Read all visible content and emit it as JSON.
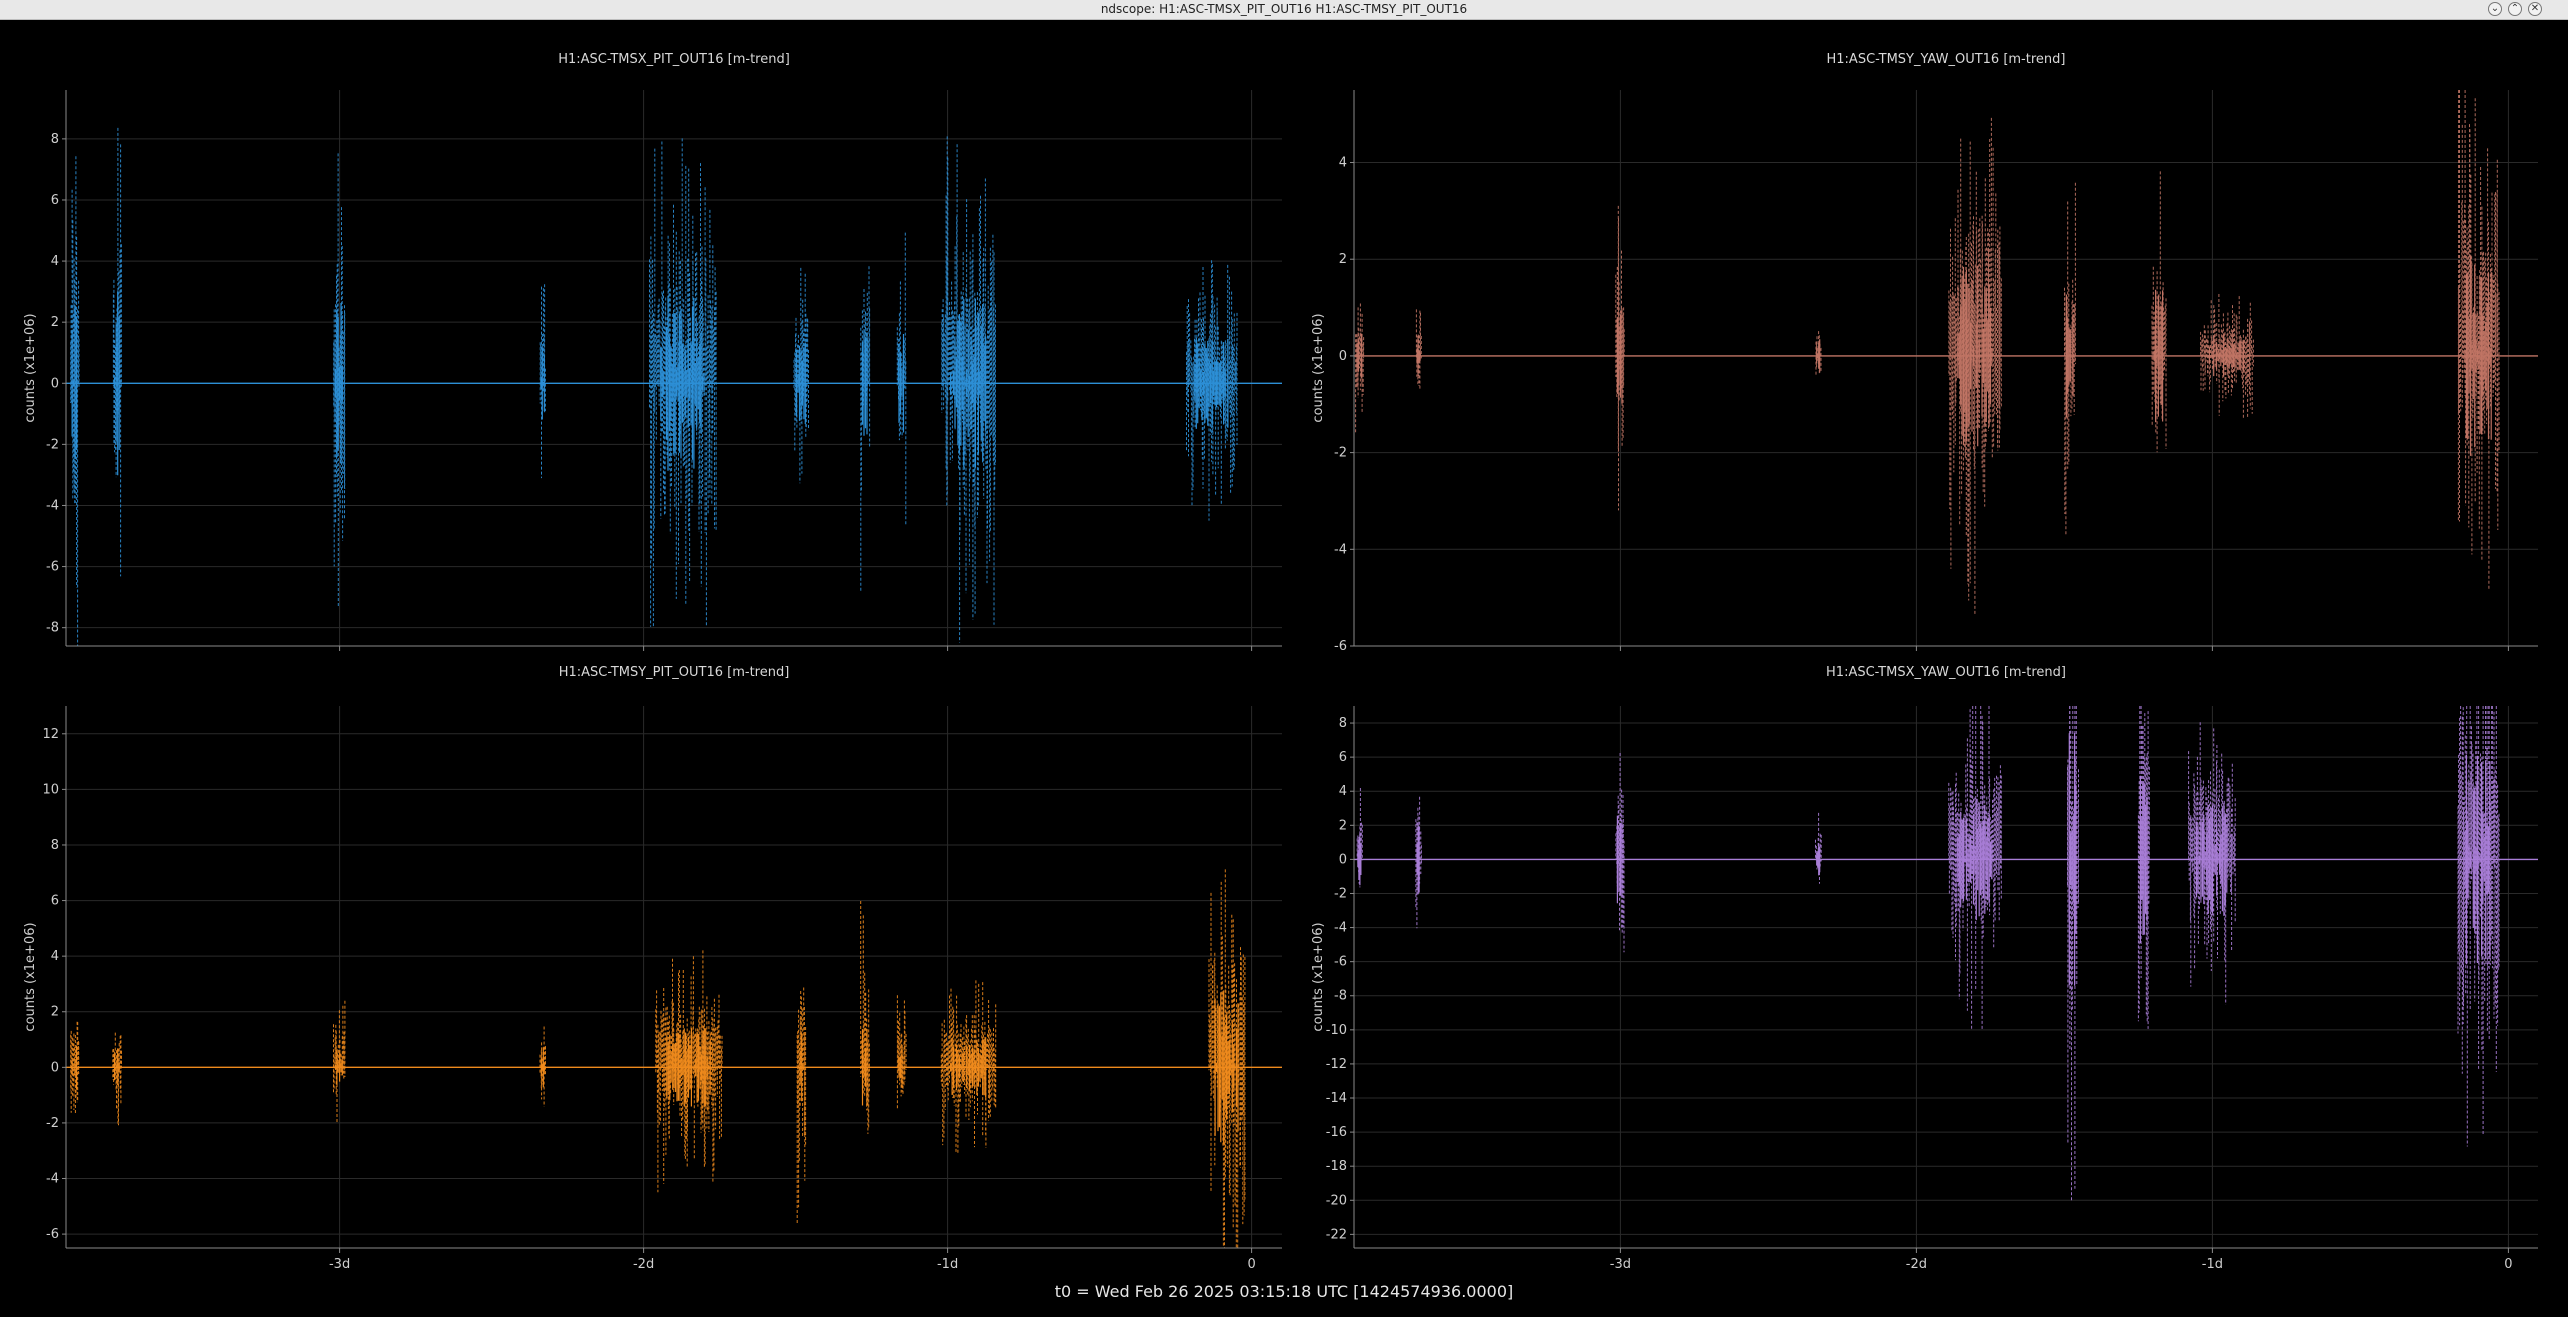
{
  "window": {
    "title": "ndscope: H1:ASC-TMSX_PIT_OUT16 H1:ASC-TMSY_PIT_OUT16"
  },
  "footer": {
    "t0": "t0 = Wed Feb 26 2025 03:15:18 UTC [1424574936.0000]"
  },
  "chart_data": [
    {
      "type": "line",
      "title": "H1:ASC-TMSX_PIT_OUT16 [m-trend]",
      "ylabel": "counts (x1e+06)",
      "color": "#2c8fd6",
      "xlim": [
        -3.9,
        0.1
      ],
      "ylim": [
        -8.6,
        9.6
      ],
      "x_ticks": [
        -3,
        -2,
        -1,
        0
      ],
      "x_tick_labels": [
        "-3d",
        "-2d",
        "-1d",
        "0"
      ],
      "y_ticks": [
        -8,
        -6,
        -4,
        -2,
        0,
        2,
        4,
        6,
        8
      ],
      "y_tick_labels": [
        "-8",
        "-6",
        "-4",
        "-2",
        "0",
        "2",
        "4",
        "6",
        "8"
      ],
      "bursts": [
        {
          "x": -3.87,
          "w": 0.03,
          "amp": 9.0
        },
        {
          "x": -3.73,
          "w": 0.03,
          "amp": 8.6
        },
        {
          "x": -3.0,
          "w": 0.04,
          "amp": 8.4
        },
        {
          "x": -2.33,
          "w": 0.02,
          "amp": 3.5
        },
        {
          "x": -1.87,
          "w": 0.22,
          "amp": 8.2
        },
        {
          "x": -1.48,
          "w": 0.05,
          "amp": 4.0
        },
        {
          "x": -1.27,
          "w": 0.03,
          "amp": 7.0
        },
        {
          "x": -1.15,
          "w": 0.03,
          "amp": 5.0
        },
        {
          "x": -0.93,
          "w": 0.18,
          "amp": 8.6
        },
        {
          "x": -0.13,
          "w": 0.17,
          "amp": 4.5
        }
      ]
    },
    {
      "type": "line",
      "title": "H1:ASC-TMSY_YAW_OUT16 [m-trend]",
      "ylabel": "counts (x1e+06)",
      "color": "#c07464",
      "xlim": [
        -3.9,
        0.1
      ],
      "ylim": [
        -6.0,
        5.5
      ],
      "x_ticks": [
        -3,
        -2,
        -1,
        0
      ],
      "x_tick_labels": [
        "-3d",
        "-2d",
        "-1d",
        "0"
      ],
      "y_ticks": [
        -6,
        -4,
        -2,
        0,
        2,
        4
      ],
      "y_tick_labels": [
        "-6",
        "-4",
        "-2",
        "0",
        "2",
        "4"
      ],
      "bursts": [
        {
          "x": -3.88,
          "w": 0.03,
          "amp": 1.8
        },
        {
          "x": -3.68,
          "w": 0.02,
          "amp": 1.3
        },
        {
          "x": -3.0,
          "w": 0.03,
          "amp": 3.8
        },
        {
          "x": -2.33,
          "w": 0.02,
          "amp": 1.0
        },
        {
          "x": -1.8,
          "w": 0.18,
          "amp": 5.4
        },
        {
          "x": -1.48,
          "w": 0.04,
          "amp": 4.0
        },
        {
          "x": -1.18,
          "w": 0.05,
          "amp": 4.0
        },
        {
          "x": -0.95,
          "w": 0.18,
          "amp": 1.3
        },
        {
          "x": -0.1,
          "w": 0.14,
          "amp": 6.0
        }
      ]
    },
    {
      "type": "line",
      "title": "H1:ASC-TMSY_PIT_OUT16 [m-trend]",
      "ylabel": "counts (x1e+06)",
      "color": "#ef8a1c",
      "xlim": [
        -3.9,
        0.1
      ],
      "ylim": [
        -6.5,
        13.0
      ],
      "x_ticks": [
        -3,
        -2,
        -1,
        0
      ],
      "x_tick_labels": [
        "-3d",
        "-2d",
        "-1d",
        "0"
      ],
      "y_ticks": [
        -6,
        -4,
        -2,
        0,
        2,
        4,
        6,
        8,
        10,
        12
      ],
      "y_tick_labels": [
        "-6",
        "-4",
        "-2",
        "0",
        "2",
        "4",
        "6",
        "8",
        "10",
        "12"
      ],
      "bursts": [
        {
          "x": -3.87,
          "w": 0.03,
          "amp": 3.0
        },
        {
          "x": -3.73,
          "w": 0.03,
          "amp": 2.2
        },
        {
          "x": -3.0,
          "w": 0.04,
          "amp": 2.6
        },
        {
          "x": -2.33,
          "w": 0.02,
          "amp": 2.2
        },
        {
          "x": -1.85,
          "w": 0.22,
          "amp": 4.5
        },
        {
          "x": -1.48,
          "w": 0.03,
          "amp": 5.8
        },
        {
          "x": -1.27,
          "w": 0.03,
          "amp": 6.2
        },
        {
          "x": -1.15,
          "w": 0.03,
          "amp": 3.0
        },
        {
          "x": -0.93,
          "w": 0.18,
          "amp": 3.2
        },
        {
          "x": -0.08,
          "w": 0.12,
          "amp": 8.5
        }
      ]
    },
    {
      "type": "line",
      "title": "H1:ASC-TMSX_YAW_OUT16 [m-trend]",
      "ylabel": "counts (x1e+06)",
      "color": "#a87dd6",
      "xlim": [
        -3.9,
        0.1
      ],
      "ylim": [
        -22.8,
        9.0
      ],
      "x_ticks": [
        -3,
        -2,
        -1,
        0
      ],
      "x_tick_labels": [
        "-3d",
        "-2d",
        "-1d",
        "0"
      ],
      "y_ticks": [
        -22,
        -20,
        -18,
        -16,
        -14,
        -12,
        -10,
        -8,
        -6,
        -4,
        -2,
        0,
        2,
        4,
        6,
        8
      ],
      "y_tick_labels": [
        "-22",
        "-20",
        "-18",
        "-16",
        "-14",
        "-12",
        "-10",
        "-8",
        "-6",
        "-4",
        "-2",
        "0",
        "2",
        "4",
        "6",
        "8"
      ],
      "bursts": [
        {
          "x": -3.88,
          "w": 0.02,
          "amp": 4.5
        },
        {
          "x": -3.68,
          "w": 0.02,
          "amp": 6.0
        },
        {
          "x": -3.0,
          "w": 0.03,
          "amp": 7.8
        },
        {
          "x": -2.33,
          "w": 0.02,
          "amp": 2.8
        },
        {
          "x": -1.8,
          "w": 0.18,
          "amp": 10.5
        },
        {
          "x": -1.47,
          "w": 0.04,
          "amp": 21.5
        },
        {
          "x": -1.23,
          "w": 0.04,
          "amp": 18.0
        },
        {
          "x": -1.0,
          "w": 0.16,
          "amp": 9.5
        },
        {
          "x": -0.1,
          "w": 0.14,
          "amp": 18.0
        }
      ]
    }
  ]
}
